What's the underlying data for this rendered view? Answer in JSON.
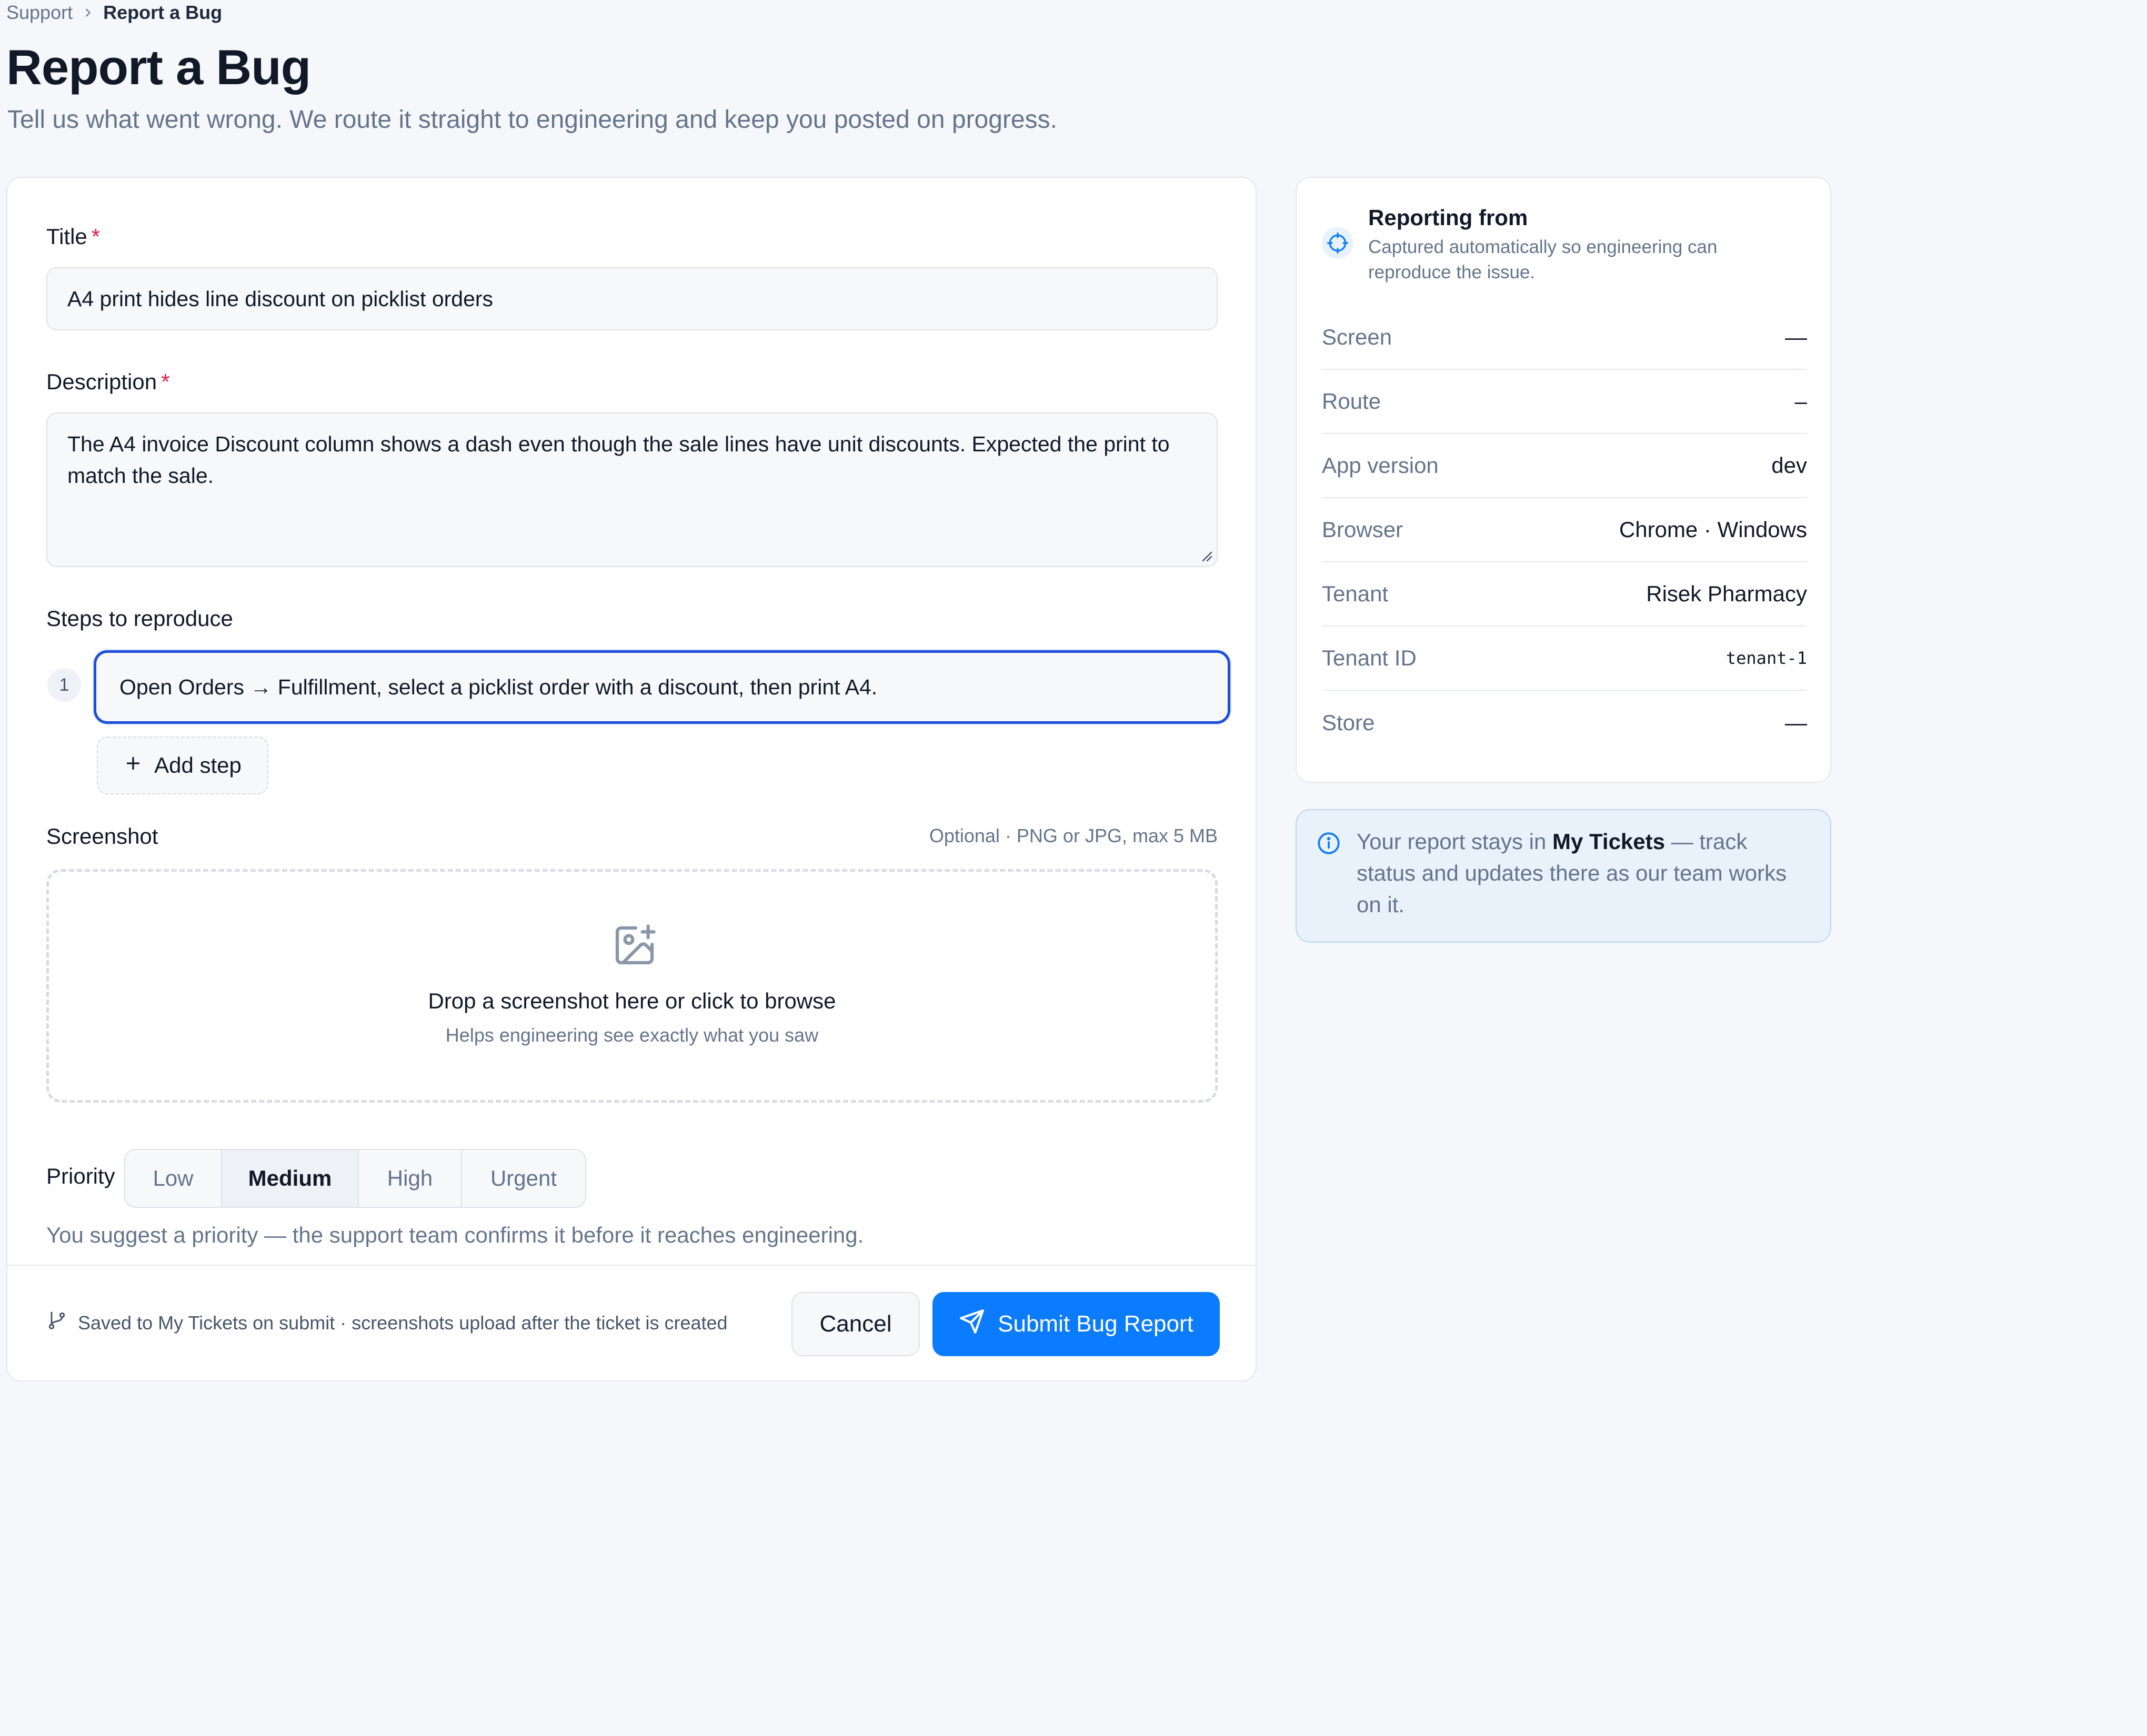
{
  "breadcrumb": {
    "parent": "Support",
    "current": "Report a Bug"
  },
  "page": {
    "title": "Report a Bug",
    "subtitle": "Tell us what went wrong. We route it straight to engineering and keep you posted on progress."
  },
  "form": {
    "title_label": "Title",
    "title_value": "A4 print hides line discount on picklist orders",
    "required_mark": "*",
    "description_label": "Description",
    "description_value": "The A4 invoice Discount column shows a dash even though the sale lines have unit discounts. Expected the print to match the sale.",
    "steps_label": "Steps to reproduce",
    "steps": [
      {
        "number": "1",
        "value": "Open Orders → Fulfillment, select a picklist order with a discount, then print A4."
      }
    ],
    "add_step_label": "Add step",
    "screenshot_label": "Screenshot",
    "screenshot_hint": "Optional · PNG or JPG, max 5 MB",
    "dropzone_title": "Drop a screenshot here or click to browse",
    "dropzone_subtitle": "Helps engineering see exactly what you saw",
    "priority_label": "Priority",
    "priority_options": [
      "Low",
      "Medium",
      "High",
      "Urgent"
    ],
    "priority_selected": "Medium",
    "priority_note": "You suggest a priority — the support team confirms it before it reaches engineering.",
    "footer_note": "Saved to My Tickets on submit · screenshots upload after the ticket is created",
    "cancel_label": "Cancel",
    "submit_label": "Submit Bug Report"
  },
  "context": {
    "title": "Reporting from",
    "subtitle": "Captured automatically so engineering can reproduce the issue.",
    "rows": [
      {
        "key": "Screen",
        "value": "—"
      },
      {
        "key": "Route",
        "value": "–"
      },
      {
        "key": "App version",
        "value": "dev"
      },
      {
        "key": "Browser",
        "value": "Chrome · Windows"
      },
      {
        "key": "Tenant",
        "value": "Risek Pharmacy"
      },
      {
        "key": "Tenant ID",
        "value": "tenant-1"
      },
      {
        "key": "Store",
        "value": "—"
      }
    ]
  },
  "info": {
    "text_before": "Your report stays in",
    "text_bold": "My Tickets",
    "text_after": "— track status and updates there as our team works on it."
  },
  "icons": {
    "breadcrumb_separator": "chevron-right-icon",
    "add_step": "plus-icon",
    "dropzone": "image-plus-icon",
    "footer": "git-branch-icon",
    "submit": "send-icon",
    "context": "crosshair-icon",
    "info": "info-icon"
  },
  "colors": {
    "accent": "#0b7cff",
    "focus_border": "#1d4ed8",
    "required": "#e11d48",
    "info_bg": "#e9f1fb"
  }
}
